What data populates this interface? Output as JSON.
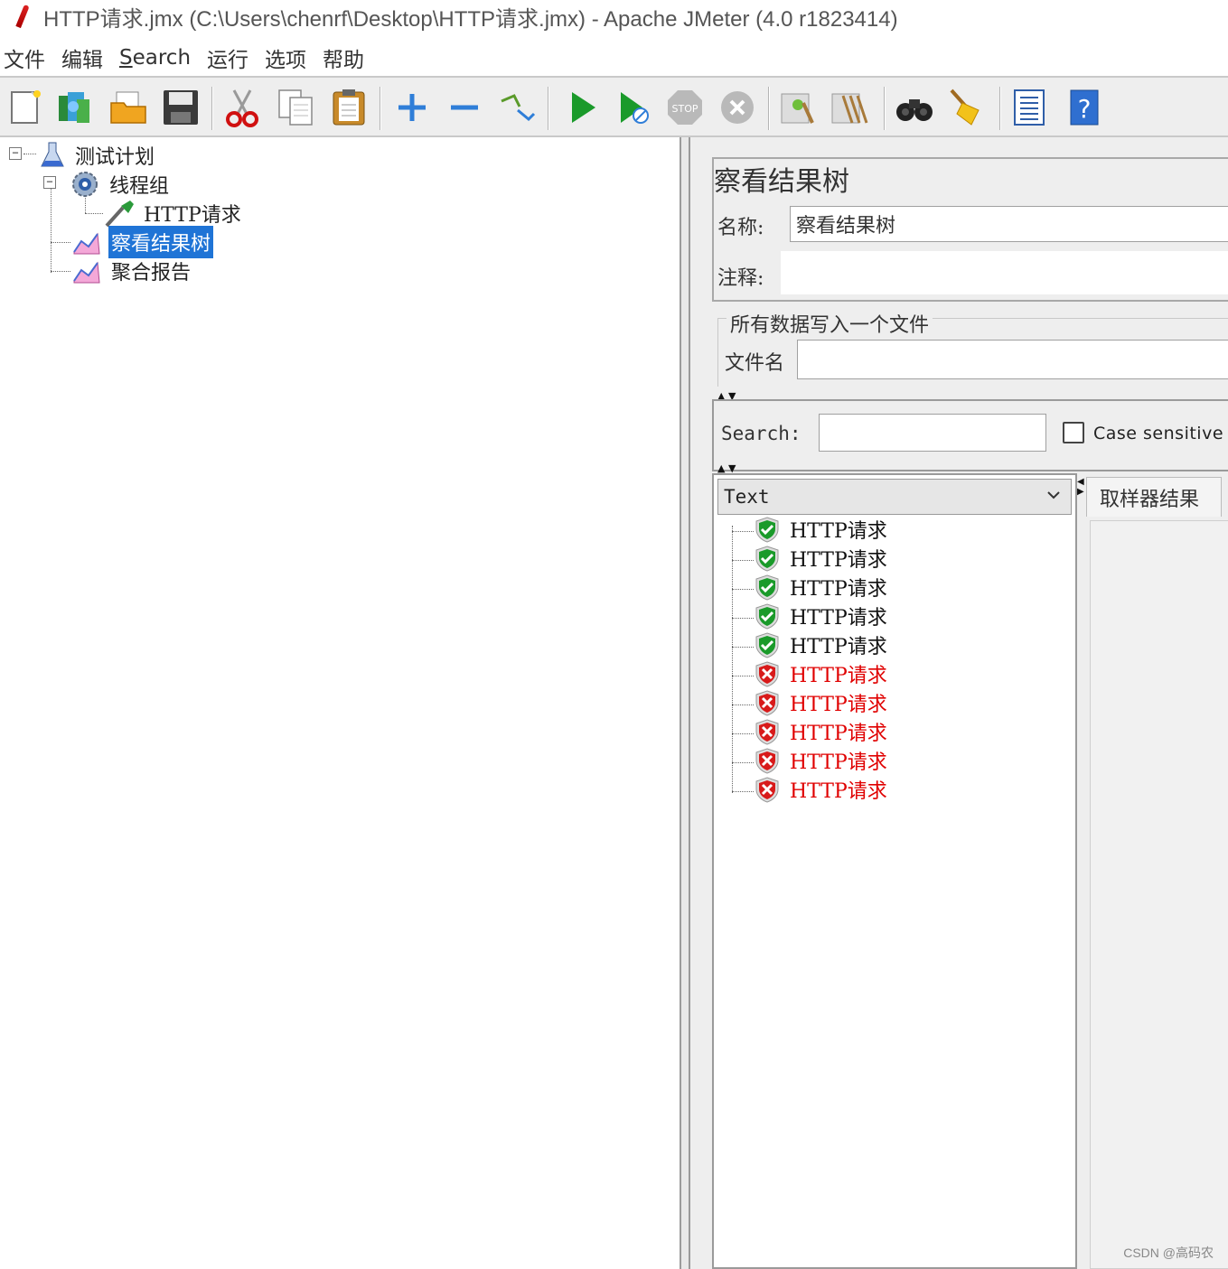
{
  "window": {
    "title": "HTTP请求.jmx (C:\\Users\\chenrf\\Desktop\\HTTP请求.jmx) - Apache JMeter (4.0 r1823414)"
  },
  "menu": {
    "file": "文件",
    "edit": "编辑",
    "search_mnemonic": "S",
    "search_rest": "earch",
    "run": "运行",
    "options": "选项",
    "help": "帮助"
  },
  "toolbar": {
    "icons": [
      "new-icon",
      "templates-icon",
      "open-icon",
      "save-icon",
      "cut-icon",
      "copy-icon",
      "paste-icon",
      "expand-icon",
      "collapse-icon",
      "toggle-icon",
      "start-icon",
      "start-no-pause-icon",
      "stop-icon",
      "shutdown-icon",
      "clear-icon",
      "clear-all-icon",
      "search-icon",
      "reset-search-icon",
      "function-helper-icon",
      "help-icon"
    ]
  },
  "tree": {
    "test_plan": "测试计划",
    "thread_group": "线程组",
    "http_request": "HTTP请求",
    "view_results_tree": "察看结果树",
    "aggregate_report": "聚合报告"
  },
  "panel": {
    "title": "察看结果树",
    "name_label": "名称:",
    "name_value": "察看结果树",
    "comment_label": "注释:",
    "comment_value": "",
    "file_group_legend": "所有数据写入一个文件",
    "filename_label": "文件名",
    "filename_value": ""
  },
  "search": {
    "label": "Search:",
    "value": "",
    "case_sensitive_label": "Case sensitive",
    "case_sensitive_checked": false
  },
  "results": {
    "renderer": "Text",
    "items": [
      {
        "label": "HTTP请求",
        "status": "success"
      },
      {
        "label": "HTTP请求",
        "status": "success"
      },
      {
        "label": "HTTP请求",
        "status": "success"
      },
      {
        "label": "HTTP请求",
        "status": "success"
      },
      {
        "label": "HTTP请求",
        "status": "success"
      },
      {
        "label": "HTTP请求",
        "status": "failure"
      },
      {
        "label": "HTTP请求",
        "status": "failure"
      },
      {
        "label": "HTTP请求",
        "status": "failure"
      },
      {
        "label": "HTTP请求",
        "status": "failure"
      },
      {
        "label": "HTTP请求",
        "status": "failure"
      }
    ],
    "tab_label": "取样器结果",
    "colors": {
      "success": "#1a9a2a",
      "failure": "#d81a1a",
      "failure_text": "#e00000"
    }
  },
  "watermark": "CSDN @高码农",
  "colors": {
    "selection": "#1f74d6",
    "panel_bg": "#eeeeee"
  }
}
